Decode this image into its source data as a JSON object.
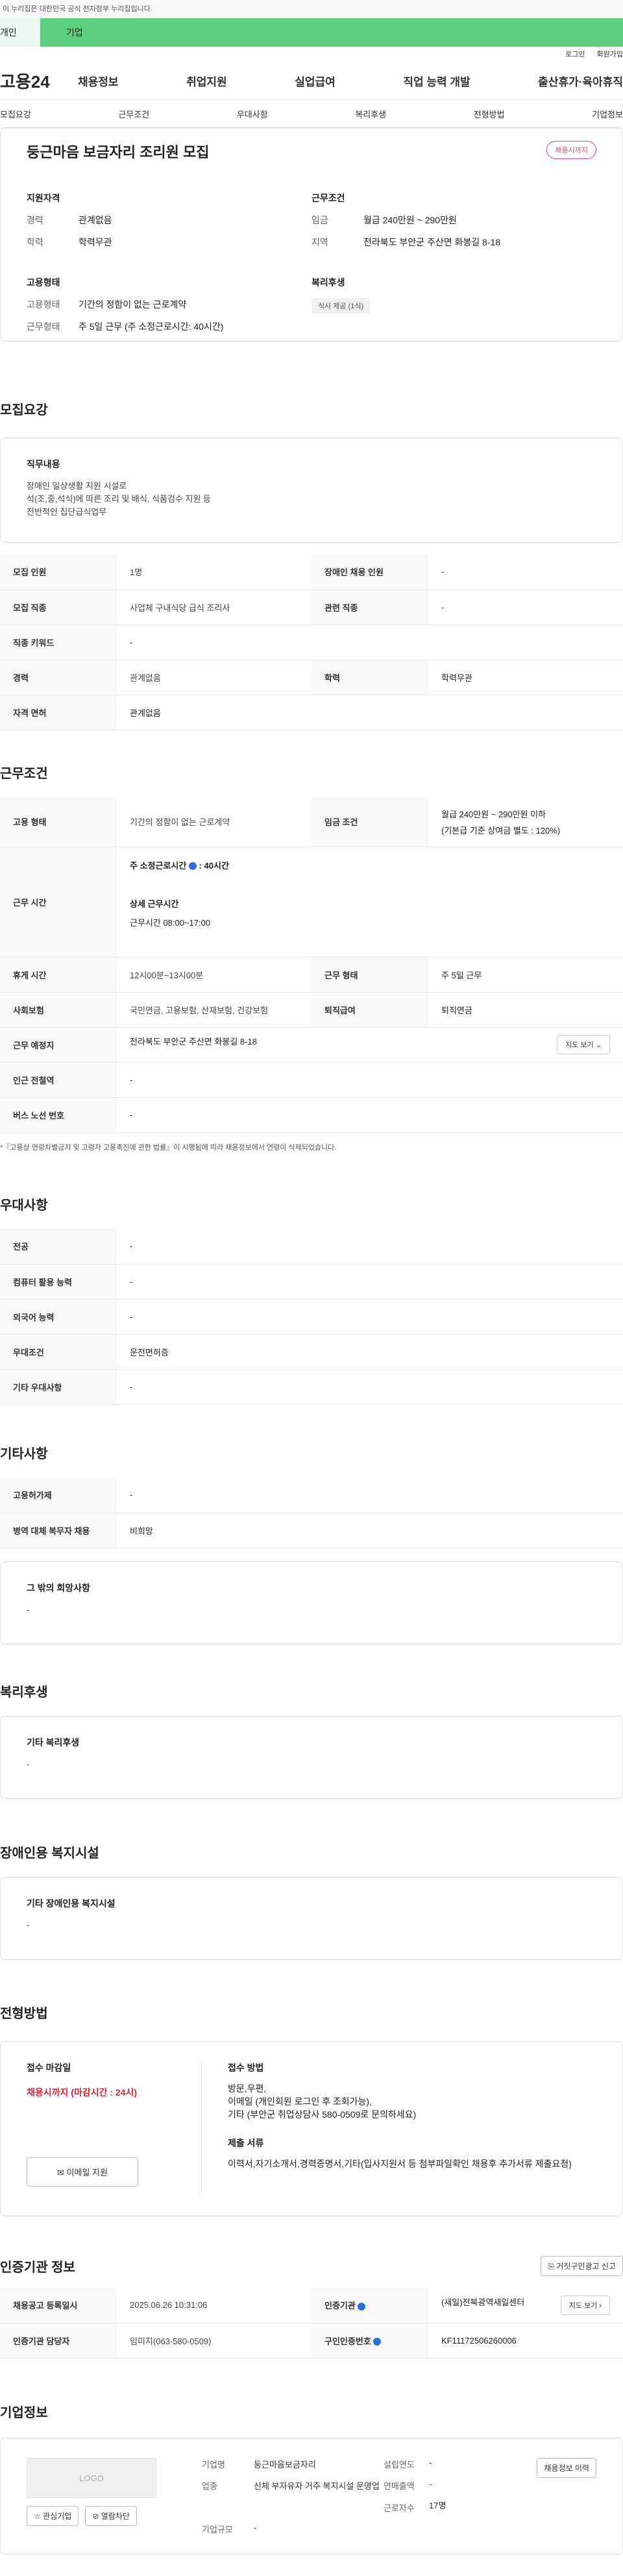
{
  "top_notice": "이 누리집은 대한민국 공식 전자정부 누리집입니다.",
  "tabs": {
    "personal": "개인",
    "corporate": "기업"
  },
  "util": {
    "login": "로그인",
    "signup": "회원가입"
  },
  "logo": "고용24",
  "gnb": [
    "채용정보",
    "취업지원",
    "실업급여",
    "직업 능력 개발",
    "출산휴가·육아휴직"
  ],
  "subnav": [
    "모집요강",
    "근무조건",
    "우대사항",
    "복리후생",
    "전형방법",
    "기업정보"
  ],
  "summary": {
    "title": "둥근마음 보금자리 조리원 모집",
    "badge": "채용시까지",
    "qual_h": "지원자격",
    "career_k": "경력",
    "career_v": "관계없음",
    "edu_k": "학력",
    "edu_v": "학력무관",
    "cond_h": "근무조건",
    "wage_k": "임금",
    "wage_v": "월급 240만원 ~ 290만원",
    "loc_k": "지역",
    "loc_v": "전라북도 부안군 주산면 화봉길 8-18",
    "emp_h": "고용형태",
    "emptype_k": "고용형태",
    "emptype_v": "기간의 정함이 없는 근로계약",
    "worktype_k": "근무형태",
    "worktype_v": "주 5일 근무 (주 소정근로시간: 40시간)",
    "welfare_h": "복리후생",
    "welfare_chip": "식사 제공 (1식)"
  },
  "recruit": {
    "heading": "모집요강",
    "duty_h": "직무내용",
    "duty_lines": [
      "장애인 일상생활 지원 시설로",
      "석(조,중,석식)에 따른 조리 및 배식, 식품검수 지원 등",
      "전반적인 집단급식업무"
    ],
    "rows": [
      [
        "모집 인원",
        "1명",
        "장애인 채용 인원",
        "-"
      ],
      [
        "모집 직종",
        "사업체 구내식당 급식 조리사",
        "관련 직종",
        "-"
      ],
      [
        "직종 키워드",
        "-",
        "",
        ""
      ],
      [
        "경력",
        "관계없음",
        "학력",
        "학력무관"
      ],
      [
        "자격 면허",
        "관계없음",
        "",
        ""
      ]
    ]
  },
  "work": {
    "heading": "근무조건",
    "emp_k": "고용 형태",
    "emp_v": "기간의 정함이 없는 근로계약",
    "wage_k": "임금 조건",
    "wage_v1": "월급 240만원 ~ 290만원 이하",
    "wage_v2": "(기본급 기준 상여금 별도 : 120%)",
    "hours_k": "근무 시간",
    "hours_v1": "주 소정근로시간",
    "hours_v1b": "40시간",
    "hours_v2": "상세 근무시간",
    "hours_v3": "근무시간 08:00~17:00",
    "break_k": "휴게 시간",
    "break_v": "12시00분~13시00분",
    "worktype_k": "근무 형태",
    "worktype_v": "주 5일 근무",
    "ins_k": "사회보험",
    "ins_v": "국민연금, 고용보험, 산재보험, 건강보험",
    "ret_k": "퇴직급여",
    "ret_v": "퇴직연금",
    "place_k": "근무 예정지",
    "place_v": "전라북도 부안군 주산면 화봉길 8-18",
    "map_btn": "지도 보기",
    "station_k": "인근 전철역",
    "station_v": "-",
    "bus_k": "버스 노선 번호",
    "bus_v": "-",
    "footnote": "*『고용상 연령차별금지 및 고령자 고용촉진에 관한 법률』이 시행됨에 따라 채용정보에서 연령이 삭제되었습니다."
  },
  "pref": {
    "heading": "우대사항",
    "rows": [
      [
        "전공",
        "-"
      ],
      [
        "컴퓨터 활용 능력",
        "-"
      ],
      [
        "외국어 능력",
        "-"
      ],
      [
        "우대조건",
        "운전면허증"
      ],
      [
        "기타 우대사항",
        "-"
      ]
    ]
  },
  "etc": {
    "heading": "기타사항",
    "rows": [
      [
        "고용허가제",
        "-"
      ],
      [
        "병역 대체 복무자 채용",
        "비희망"
      ]
    ],
    "box_h": "그 밖의 희망사항",
    "box_v": "-"
  },
  "welfare": {
    "heading": "복리후생",
    "box_h": "기타 복리후생",
    "box_v": "-"
  },
  "disabled": {
    "heading": "장애인용 복지시설",
    "box_h": "기타 장애인용 복지시설",
    "box_v": "-"
  },
  "selection": {
    "heading": "전형방법",
    "deadline_h": "접수 마감일",
    "deadline_v": "채용시까지 (마감시간 : 24시)",
    "email_btn": "이메일 지원",
    "method_h": "접수 방법",
    "method_v": [
      "방문,우편,",
      "이메일 (개인회원 로그인 후 조회가능),",
      "기타 (부안군 취업상담사 580-0509로 문의하세요)"
    ],
    "docs_h": "제출 서류",
    "docs_v": "이력서,자기소개서,경력증명서,기타(입사지원서 등 첨부파일확인 채용후 추가서류 제출요청)"
  },
  "cert": {
    "heading": "인증기관 정보",
    "report_btn": "거짓구인광고 신고",
    "reg_k": "채용공고 등록일시",
    "reg_v": "2025.06.26 10:31:06",
    "org_k": "인증기관",
    "org_v": "(새일)전북광역새일센터",
    "map_btn": "지도 보기",
    "mgr_k": "인증기관 담당자",
    "mgr_v": "임미지(063-580-0509)",
    "num_k": "구인인증번호",
    "num_v": "KF11172506260006"
  },
  "company": {
    "heading": "기업정보",
    "logo_text": "LOGO",
    "fav_btn": "관심기업",
    "block_btn": "열람차단",
    "history_btn": "채용정보 이력",
    "name_k": "기업명",
    "name_v": "둥근마음보금자리",
    "year_k": "설립연도",
    "year_v": "-",
    "biz_k": "업종",
    "biz_v": "신체 부자유자 거주 복지시설 운영업",
    "sales_k": "연매출액",
    "sales_v": "-",
    "emp_k": "근로자수",
    "emp_v": "17명",
    "size_k": "기업규모",
    "size_v": "-"
  }
}
